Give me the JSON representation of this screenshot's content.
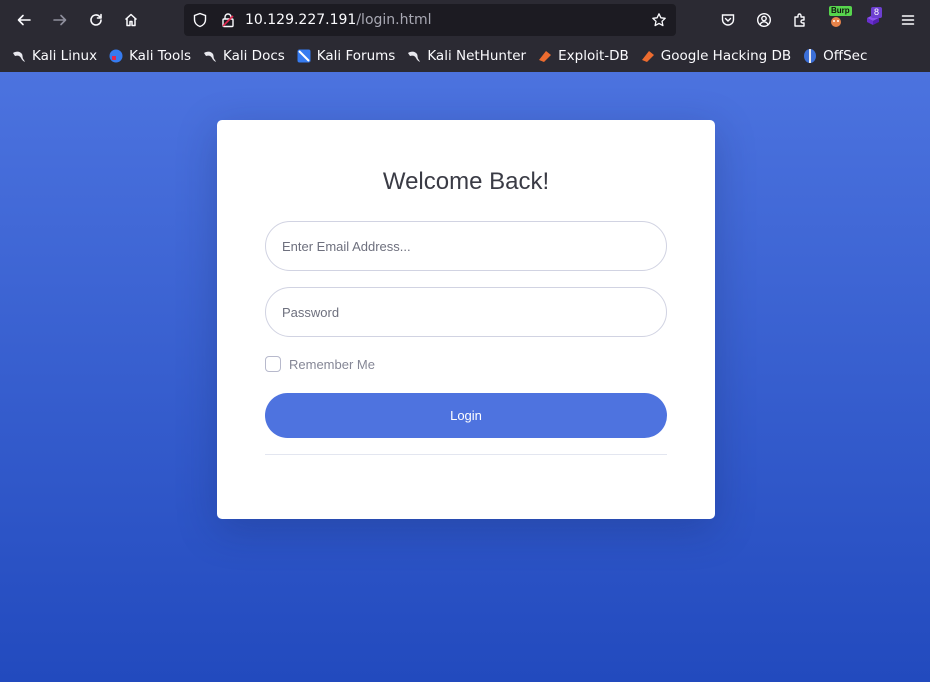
{
  "browser": {
    "url_host": "10.129.227.191",
    "url_path": "/login.html",
    "extension_badges": {
      "burp": "Burp",
      "count": "8"
    },
    "toolbar_icons": [
      "back-icon",
      "forward-icon",
      "reload-icon",
      "home-icon",
      "shield-icon",
      "lock-icon",
      "star-icon",
      "pocket-icon",
      "account-icon",
      "extensions-icon",
      "burp-icon",
      "purple-extension-icon",
      "menu-icon"
    ]
  },
  "bookmarks": [
    {
      "label": "Kali Linux",
      "icon": "kali-dragon-icon"
    },
    {
      "label": "Kali Tools",
      "icon": "kali-tools-icon"
    },
    {
      "label": "Kali Docs",
      "icon": "kali-dragon-icon"
    },
    {
      "label": "Kali Forums",
      "icon": "kali-forums-icon"
    },
    {
      "label": "Kali NetHunter",
      "icon": "kali-dragon-icon"
    },
    {
      "label": "Exploit-DB",
      "icon": "exploit-db-icon"
    },
    {
      "label": "Google Hacking DB",
      "icon": "exploit-db-icon"
    },
    {
      "label": "OffSec",
      "icon": "offsec-icon"
    }
  ],
  "login": {
    "title": "Welcome Back!",
    "email_placeholder": "Enter Email Address...",
    "password_placeholder": "Password",
    "remember_label": "Remember Me",
    "button_label": "Login"
  },
  "colors": {
    "page_gradient_top": "#4c73df",
    "page_gradient_bottom": "#224abe",
    "button": "#4e73df",
    "browser_chrome": "#2b2a33"
  }
}
